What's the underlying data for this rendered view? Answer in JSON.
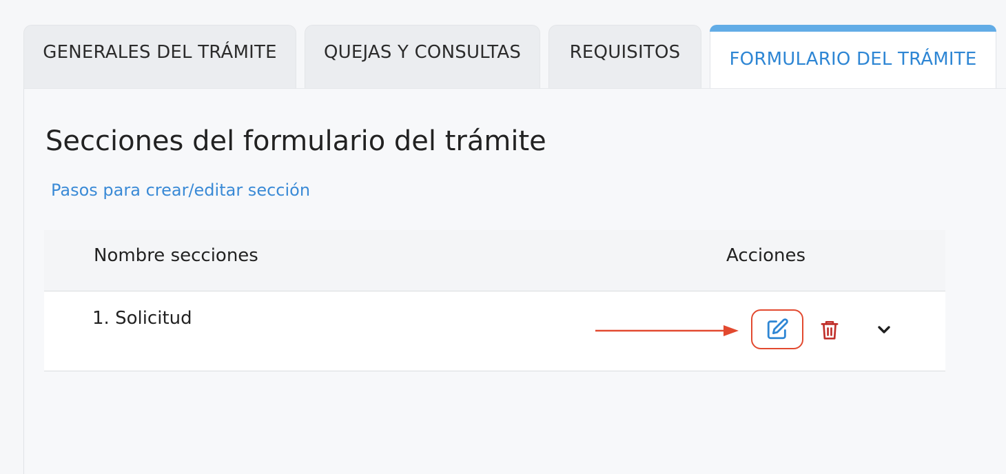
{
  "tabs": [
    {
      "label": "GENERALES DEL TRÁMITE",
      "active": false
    },
    {
      "label": "QUEJAS Y CONSULTAS",
      "active": false
    },
    {
      "label": "REQUISITOS",
      "active": false
    },
    {
      "label": "FORMULARIO DEL TRÁMITE",
      "active": true
    }
  ],
  "page": {
    "title": "Secciones del formulario del trámite",
    "help_link": "Pasos para crear/editar sección"
  },
  "table": {
    "columns": [
      "Nombre secciones",
      "Acciones"
    ],
    "rows": [
      {
        "name": "1. Solicitud",
        "actions": [
          "edit-icon",
          "trash-icon",
          "chevron-down-icon"
        ]
      }
    ]
  },
  "colors": {
    "accent": "#2e86d4",
    "active_tab_bar": "#62ace6",
    "delete": "#c0302b",
    "highlight": "#e2492f"
  }
}
